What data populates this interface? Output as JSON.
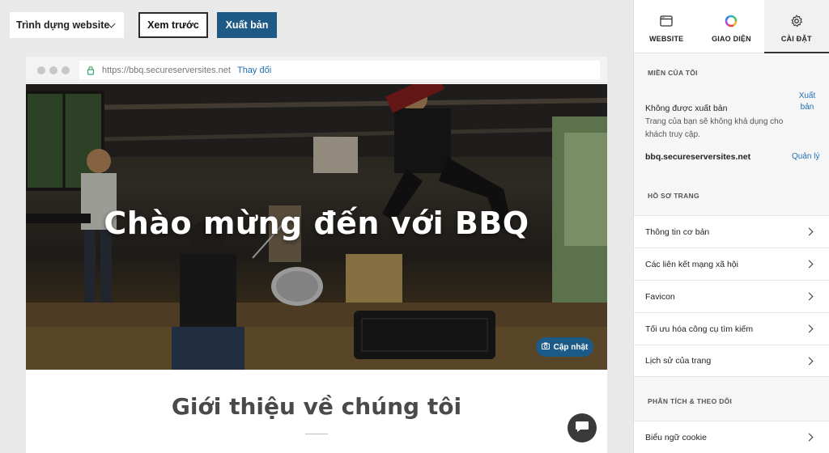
{
  "toolbar": {
    "builder_label": "Trình dựng website",
    "preview_label": "Xem trước",
    "publish_label": "Xuất bản"
  },
  "browser": {
    "url": "https://bbq.secureserversites.net",
    "change_link": "Thay đổi"
  },
  "site": {
    "hero_title": "Chào mừng đến với BBQ",
    "update_button": "Cập nhật",
    "about_title": "Giới thiệu về chúng tôi"
  },
  "panel": {
    "tabs": [
      {
        "label": "WEBSITE",
        "icon": "browser-window-icon"
      },
      {
        "label": "GIAO DIỆN",
        "icon": "color-wheel-icon"
      },
      {
        "label": "CÀI ĐẶT",
        "icon": "gear-icon",
        "active": true
      }
    ],
    "domain_section": {
      "heading": "MIỀN CỦA TÔI",
      "status_title": "Không được xuất bản",
      "status_desc": "Trang của bạn sẽ không khả dụng cho khách truy cập.",
      "publish_link": "Xuất bản",
      "domain": "bbq.secureserversites.net",
      "manage_link": "Quản lý"
    },
    "profile_section": {
      "heading": "HỒ SƠ TRANG",
      "items": [
        {
          "label": "Thông tin cơ bản"
        },
        {
          "label": "Các liên kết mạng xã hội"
        },
        {
          "label": "Favicon"
        },
        {
          "label": "Tối ưu hóa công cụ tìm kiếm"
        },
        {
          "label": "Lịch sử của trang"
        }
      ]
    },
    "analytics_section": {
      "heading": "PHÂN TÍCH & THEO DÕI",
      "items": [
        {
          "label": "Biểu ngữ cookie"
        }
      ]
    }
  },
  "colors": {
    "publish_button": "#1f5a86",
    "link": "#1f6fb3",
    "panel_bg": "#f6f6f6"
  }
}
